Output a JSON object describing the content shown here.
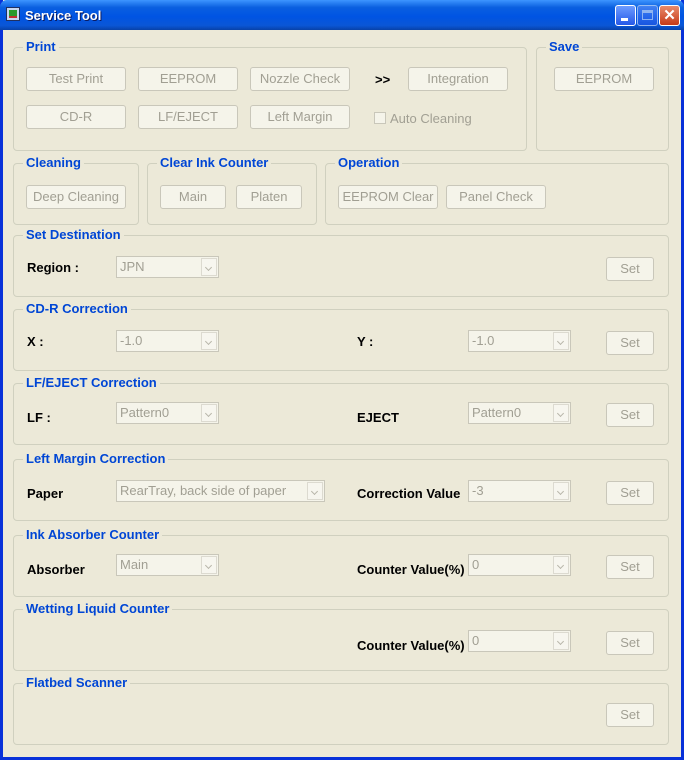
{
  "window": {
    "title": "Service Tool"
  },
  "print": {
    "title": "Print",
    "test_print": "Test Print",
    "eeprom": "EEPROM",
    "nozzle_check": "Nozzle Check",
    "arrow": ">>",
    "integration": "Integration",
    "cdr": "CD-R",
    "lf_eject": "LF/EJECT",
    "left_margin": "Left Margin",
    "auto_cleaning": "Auto Cleaning"
  },
  "save": {
    "title": "Save",
    "eeprom": "EEPROM"
  },
  "cleaning": {
    "title": "Cleaning",
    "deep_cleaning": "Deep Cleaning"
  },
  "clear_ink": {
    "title": "Clear Ink Counter",
    "main": "Main",
    "platen": "Platen"
  },
  "operation": {
    "title": "Operation",
    "eeprom_clear": "EEPROM Clear",
    "panel_check": "Panel Check"
  },
  "set_destination": {
    "title": "Set Destination",
    "region_label": "Region :",
    "region_value": "JPN",
    "set": "Set"
  },
  "cdr_correction": {
    "title": "CD-R Correction",
    "x_label": "X :",
    "x_value": "-1.0",
    "y_label": "Y :",
    "y_value": "-1.0",
    "set": "Set"
  },
  "lf_eject_correction": {
    "title": "LF/EJECT Correction",
    "lf_label": "LF :",
    "lf_value": "Pattern0",
    "eject_label": "EJECT",
    "eject_value": "Pattern0",
    "set": "Set"
  },
  "left_margin_correction": {
    "title": "Left Margin Correction",
    "paper_label": "Paper",
    "paper_value": "RearTray, back side of paper",
    "corr_label": "Correction Value",
    "corr_value": "-3",
    "set": "Set"
  },
  "ink_absorber": {
    "title": "Ink Absorber Counter",
    "absorber_label": "Absorber",
    "absorber_value": "Main",
    "counter_label": "Counter Value(%)",
    "counter_value": "0",
    "set": "Set"
  },
  "wetting_liquid": {
    "title": "Wetting Liquid Counter",
    "counter_label": "Counter Value(%)",
    "counter_value": "0",
    "set": "Set"
  },
  "flatbed": {
    "title": "Flatbed Scanner",
    "set": "Set"
  }
}
